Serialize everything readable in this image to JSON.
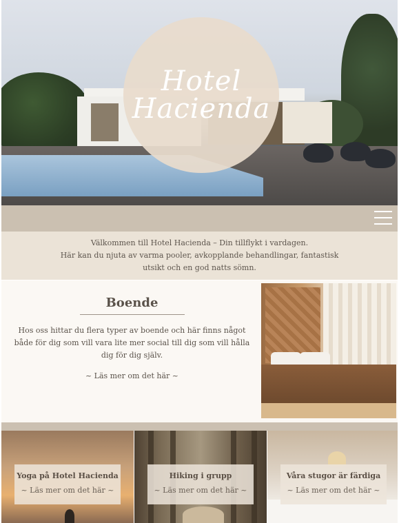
{
  "hero": {
    "logo_line1": "Hotel",
    "logo_line2": "Hacienda"
  },
  "nav": {
    "menu_icon": "hamburger-menu-icon"
  },
  "welcome": {
    "line1": "Välkommen till Hotel Hacienda – Din tillflykt i vardagen.",
    "line2": "Här kan du njuta av varma pooler, avkopplande behandlingar, fantastisk",
    "line3": "utsikt och en god natts sömn."
  },
  "boende": {
    "title": "Boende",
    "body": "Hos oss hittar du flera typer av boende och här finns något både för dig som vill vara lite mer social till dig som vill hålla dig för dig själv.",
    "link": "~ Läs mer om det här ~"
  },
  "cards": [
    {
      "title": "Yoga på Hotel Hacienda",
      "link": "~ Läs mer om det här ~"
    },
    {
      "title": "Hiking i grupp",
      "link": "~ Läs mer om det här ~"
    },
    {
      "title": "Våra stugor är färdiga",
      "link": "~ Läs mer om det här ~"
    }
  ],
  "colors": {
    "nav_bar": "#cbc0b1",
    "welcome_bg": "#ebe3d7",
    "section_bg": "#fbf8f4",
    "logo_circle": "#e8dccc"
  }
}
